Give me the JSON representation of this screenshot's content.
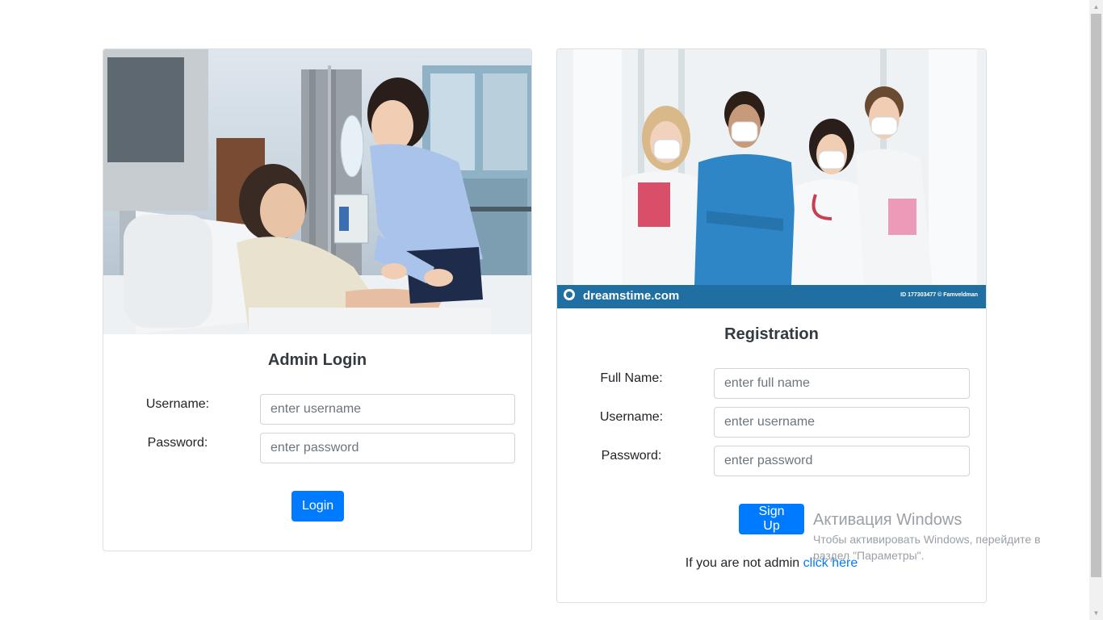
{
  "login": {
    "title": "Admin Login",
    "username_label": "Username:",
    "username_placeholder": "enter username",
    "password_label": "Password:",
    "password_placeholder": "enter password",
    "button": "Login"
  },
  "registration": {
    "title": "Registration",
    "fullname_label": "Full Name:",
    "fullname_placeholder": "enter full name",
    "username_label": "Username:",
    "username_placeholder": "enter username",
    "password_label": "Password:",
    "password_placeholder": "enter password",
    "button": "Sign Up",
    "footer_text": "If you are not admin ",
    "footer_link": "click here",
    "photo_watermark_logo": "dreamstime.com",
    "photo_watermark_id": "ID 177303477 © Famveldman"
  },
  "windows_activation": {
    "title": "Активация Windows",
    "message": "Чтобы активировать Windows, перейдите в раздел \"Параметры\"."
  },
  "colors": {
    "primary": "#007bff",
    "border": "#ced4da",
    "title": "#343a40"
  }
}
